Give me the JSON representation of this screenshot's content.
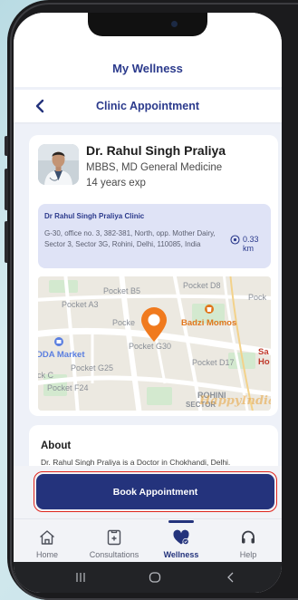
{
  "app": {
    "title": "My Wellness"
  },
  "header": {
    "title": "Clinic Appointment"
  },
  "doctor": {
    "name": "Dr. Rahul Singh Praliya",
    "qualification": "MBBS, MD General Medicine",
    "experience": "14 years exp"
  },
  "clinic": {
    "name": "Dr Rahul Singh Praliya Clinic",
    "address": "G-30, office no. 3, 382-381, North, opp. Mother Dairy, Sector 3, Sector 3G, Rohini, Delhi, 110085, India",
    "distance": "0.33 km"
  },
  "map": {
    "labels": {
      "pocket_b5": "Pocket B5",
      "pocket_d8": "Pocket D8",
      "pocket_a3": "Pocket A3",
      "pocket_partial_right": "Pock",
      "pocket_partial_mid": "Pocke",
      "badzi_momos": "Badzi Momos",
      "dda_market": "DDA Market",
      "pocket_g30": "Pocket G30",
      "pocket_d17": "Pocket D17",
      "edge_sa": "Sa",
      "edge_ho": "Ho",
      "pocket_g25": "Pocket G25",
      "pocket_c": "ck C",
      "pocket_f24": "Pocket F24",
      "rohini": "ROHINI",
      "sector": "SECTOR",
      "watermark": "HappyIndia"
    },
    "colors": {
      "marker": "#f07a1e",
      "poi": "#e0761c",
      "market": "#5b7fe0"
    }
  },
  "about": {
    "title": "About",
    "text": "Dr. Rahul Singh Praliya is a Doctor in Chokhandi, Delhi."
  },
  "cta": {
    "label": "Book Appointment"
  },
  "tabs": [
    {
      "label": "Home",
      "icon": "home-icon"
    },
    {
      "label": "Consultations",
      "icon": "consultations-icon"
    },
    {
      "label": "Wellness",
      "icon": "wellness-heart-icon",
      "active": true
    },
    {
      "label": "Help",
      "icon": "headset-icon"
    }
  ],
  "colors": {
    "primary": "#24337c",
    "accent_red": "#e0261e",
    "clinic_bg": "#dfe3f6"
  }
}
